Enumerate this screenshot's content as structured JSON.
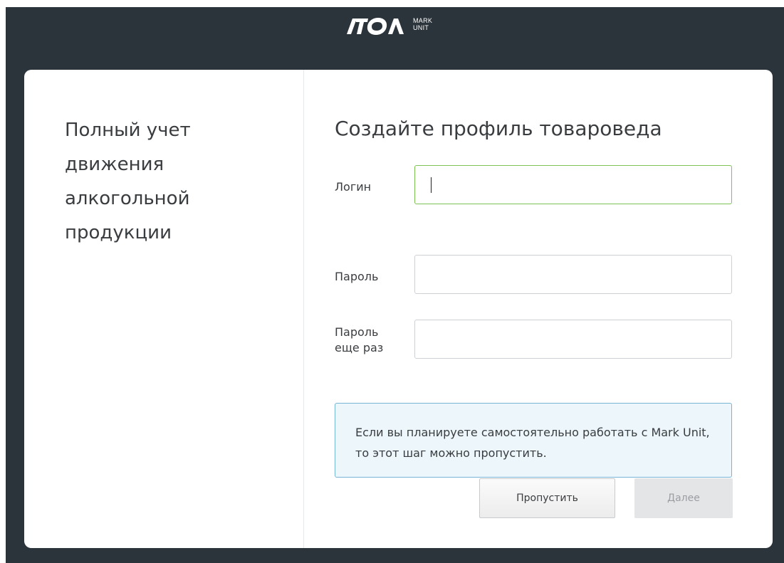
{
  "header": {
    "logo_text": "ATOL",
    "logo_sub_line1": "MARK",
    "logo_sub_line2": "UNIT"
  },
  "left_panel": {
    "tagline": "Полный учет\nдвижения\nалкогольной\nпродукции"
  },
  "form": {
    "title": "Создайте профиль товароведа",
    "login": {
      "label": "Логин",
      "value": "",
      "placeholder": ""
    },
    "password": {
      "label": "Пароль",
      "value": "",
      "placeholder": ""
    },
    "password_repeat": {
      "label": "Пароль\nеще раз",
      "value": "",
      "placeholder": ""
    }
  },
  "info": {
    "text": "Если вы планируете самостоятельно работать с Mark Unit, то этот шаг можно пропустить."
  },
  "buttons": {
    "skip_label": "Пропустить",
    "next_label": "Далее"
  },
  "colors": {
    "frame_background": "#2c343b",
    "focus_border": "#7cc353",
    "info_background": "#ecf6fb",
    "info_border": "#77b5d6"
  }
}
